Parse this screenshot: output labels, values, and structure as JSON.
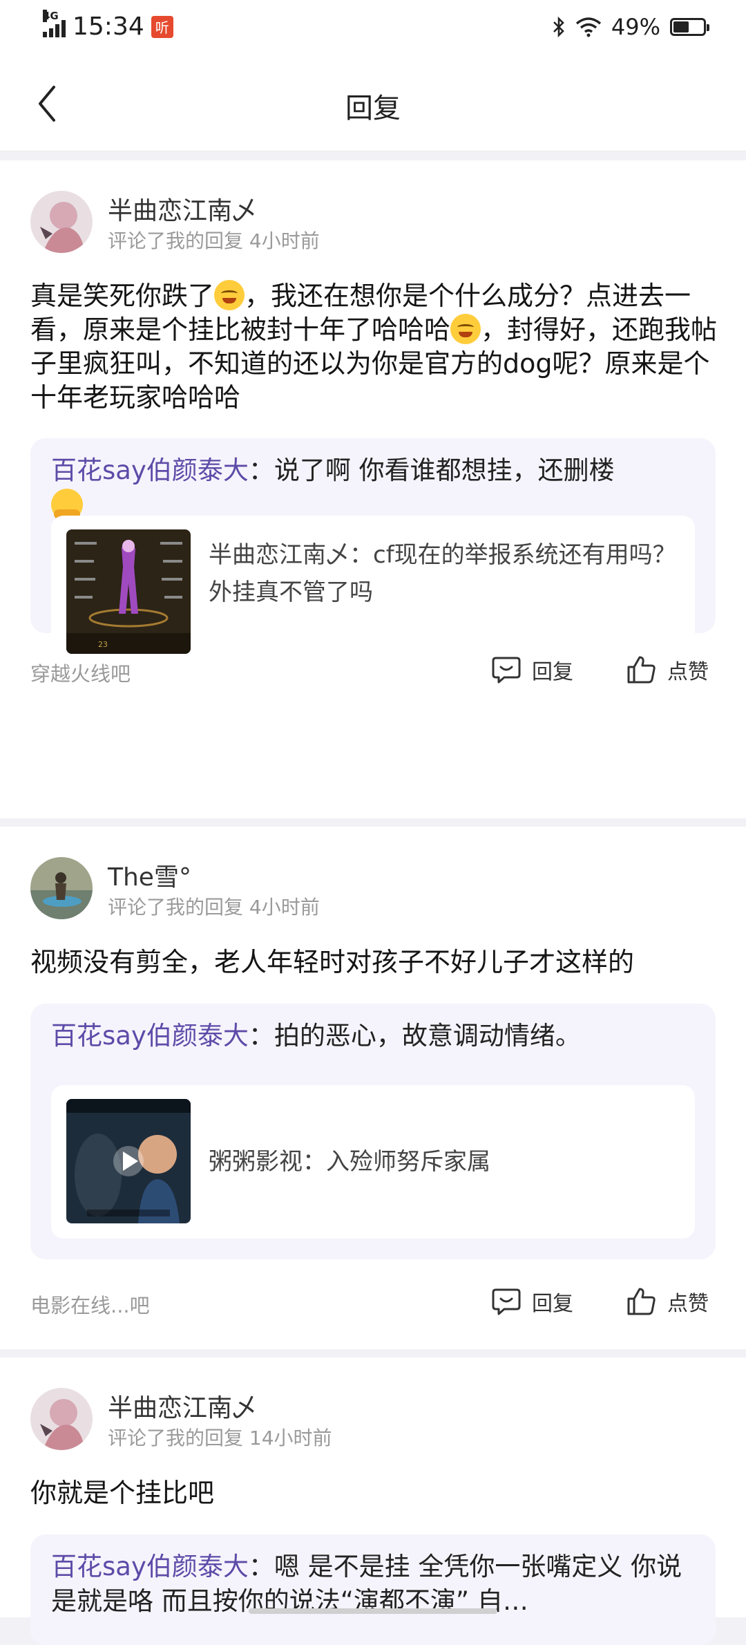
{
  "status_bar": {
    "network": "4G",
    "time": "15:34",
    "listen_badge": "听",
    "battery": "49%"
  },
  "header": {
    "title": "回复"
  },
  "notifications": [
    {
      "user": "半曲恋江南乄",
      "meta": "评论了我的回复  4小时前",
      "text_parts": [
        "真是笑死你跌了",
        "，我还在想你是个什么成分？点进去一看，原来是个挂比被封十年了哈哈哈",
        "，封得好，还跑我帖子里疯狂叫，不知道的还以为你是官方的dog呢？原来是个十年老玩家哈哈哈"
      ],
      "quote_name": "百花say伯颜泰大",
      "quote_text": "：说了啊 你看谁都想挂，还删楼",
      "original_text": "半曲恋江南乄：cf现在的举报系统还有用吗？外挂真不管了吗",
      "thumb_label_1": "23",
      "forum": "穿越火线吧",
      "reply_label": "回复",
      "like_label": "点赞"
    },
    {
      "user": "The雪°",
      "meta": "评论了我的回复  4小时前",
      "text": "视频没有剪全，老人年轻时对孩子不好儿子才这样的",
      "quote_name": "百花say伯颜泰大",
      "quote_text": "：拍的恶心，故意调动情绪。",
      "original_text": "粥粥影视：入殓师努斥家属",
      "forum": "电影在线...吧",
      "reply_label": "回复",
      "like_label": "点赞"
    },
    {
      "user": "半曲恋江南乄",
      "meta": "评论了我的回复  14小时前",
      "text": "你就是个挂比吧",
      "quote_name": "百花say伯颜泰大",
      "quote_text": "：嗯 是不是挂 全凭你一张嘴定义 你说是就是咯 而且按你的说法“演都不演” 自…"
    }
  ],
  "colors": {
    "accent_name": "#5e4ba8",
    "quote_bg": "#f5f4fc",
    "page_bg": "#f2f1f6"
  }
}
